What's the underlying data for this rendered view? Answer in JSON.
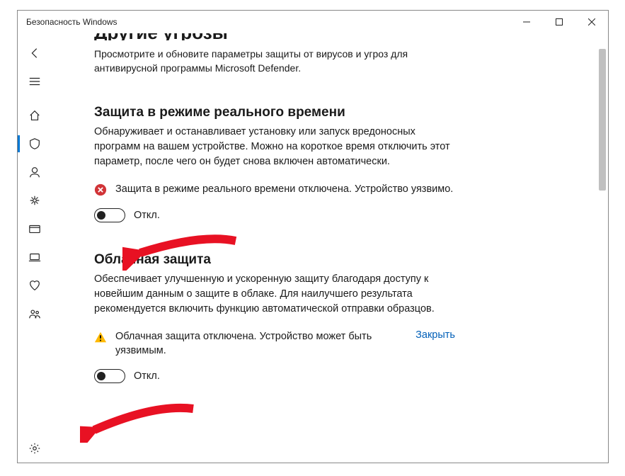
{
  "window_title": "Безопасность Windows",
  "cutoff_heading": "Другие угрозы",
  "intro": "Просмотрите и обновите параметры защиты от вирусов и угроз для антивирусной программы Microsoft Defender.",
  "sections": {
    "realtime": {
      "title": "Защита в режиме реального времени",
      "desc": "Обнаруживает и останавливает установку или запуск вредоносных программ на вашем устройстве. Можно на короткое время отключить этот параметр, после чего он будет снова включен автоматически.",
      "alert_kind": "error",
      "alert_msg": "Защита в режиме реального времени отключена. Устройство уязвимо.",
      "toggle_state": "off",
      "toggle_label": "Откл."
    },
    "cloud": {
      "title": "Облачная защита",
      "desc": "Обеспечивает улучшенную и ускоренную защиту благодаря доступу к новейшим данным о защите в облаке. Для наилучшего результата рекомендуется включить функцию автоматической отправки образцов.",
      "alert_kind": "warning",
      "alert_msg": "Облачная защита отключена. Устройство может быть уязвимым.",
      "alert_link": "Закрыть",
      "toggle_state": "off",
      "toggle_label": "Откл."
    }
  },
  "sidebar": {
    "items": [
      {
        "name": "back-icon"
      },
      {
        "name": "hamburger-icon"
      },
      {
        "name": "home-icon"
      },
      {
        "name": "shield-icon",
        "active": true
      },
      {
        "name": "account-icon"
      },
      {
        "name": "firewall-icon"
      },
      {
        "name": "app-browser-icon"
      },
      {
        "name": "device-security-icon"
      },
      {
        "name": "device-health-icon"
      },
      {
        "name": "family-icon"
      }
    ],
    "footer": {
      "name": "settings-icon"
    }
  }
}
